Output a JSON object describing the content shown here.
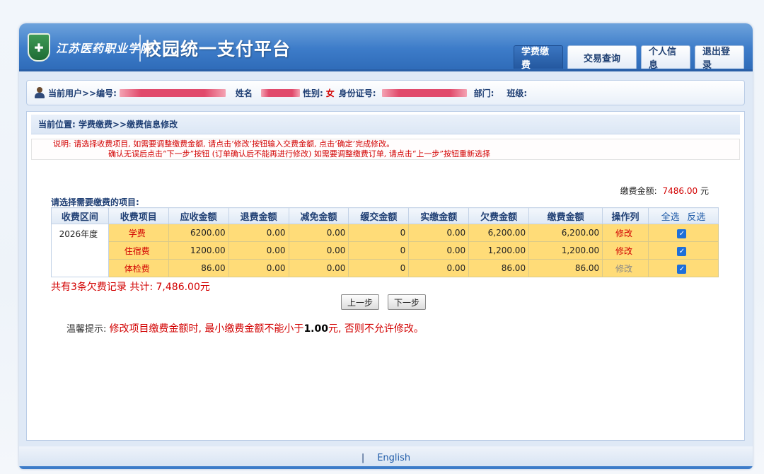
{
  "header": {
    "school_name": "江苏医药职业学院",
    "platform_title": "校园统一支付平台",
    "nav": [
      "学费缴费",
      "交易查询",
      "个人信息",
      "退出登录"
    ]
  },
  "userbar": {
    "current_user_label": "当前用户>>编号:",
    "name_label": "姓名",
    "gender_label": "性别:",
    "gender_value": "女",
    "id_label": "身份证号:",
    "dept_label": "部门:",
    "class_label": "班级:"
  },
  "location": "当前位置: 学费缴费>>缴费信息修改",
  "notice": {
    "line1": "说明: 请选择收费项目, 如需要调整缴费金额, 请点击‘修改’按钮输入交费金额, 点击‘确定’完成修改。",
    "line2": "确认无误后点击“下一步”按钮 (订单确认后不能再进行修改) 如需要调整缴费订单, 请点击“上一步”按钮重新选择"
  },
  "fee_total": {
    "label": "缴费金额:",
    "amount": "7486.00",
    "unit": "元"
  },
  "select_label": "请选择需要缴费的项目:",
  "table": {
    "headers": [
      "收费区间",
      "收费项目",
      "应收金额",
      "退费金额",
      "减免金额",
      "缓交金额",
      "实缴金额",
      "欠费金额",
      "缴费金额",
      "操作列"
    ],
    "select_all": "全选",
    "invert": "反选",
    "period": "2026年度",
    "rows": [
      {
        "item": "学费",
        "receivable": "6200.00",
        "refund": "0.00",
        "reduction": "0.00",
        "deferred": "0",
        "paid": "0.00",
        "arrears": "6,200.00",
        "payment": "6,200.00",
        "op": "修改",
        "op_enabled": true,
        "checked": true
      },
      {
        "item": "住宿费",
        "receivable": "1200.00",
        "refund": "0.00",
        "reduction": "0.00",
        "deferred": "0",
        "paid": "0.00",
        "arrears": "1,200.00",
        "payment": "1,200.00",
        "op": "修改",
        "op_enabled": true,
        "checked": true
      },
      {
        "item": "体检费",
        "receivable": "86.00",
        "refund": "0.00",
        "reduction": "0.00",
        "deferred": "0",
        "paid": "0.00",
        "arrears": "86.00",
        "payment": "86.00",
        "op": "修改",
        "op_enabled": false,
        "checked": true
      }
    ]
  },
  "summary": "共有3条欠费记录 共计: 7,486.00元",
  "buttons": {
    "prev": "上一步",
    "next": "下一步"
  },
  "tip": {
    "label": "温馨提示:",
    "text_before": "修改项目缴费金额时, 最小缴费金额不能小于",
    "min_amount": "1.00",
    "text_after": "元, 否则不允许修改。"
  },
  "footer": {
    "separator": "|",
    "language": "English"
  }
}
